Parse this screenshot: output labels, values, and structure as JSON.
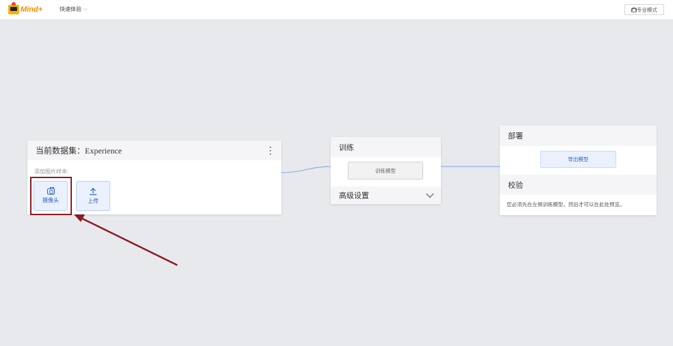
{
  "app": {
    "logo_text": "Mind+",
    "mode_menu_label": "快速体验",
    "pro_mode_label": "专业模式"
  },
  "dataset": {
    "title": "当前数据集：Experience",
    "subtitle": "添加图片样本:",
    "webcam_label": "摄像头",
    "upload_label": "上传"
  },
  "train": {
    "title": "训练",
    "train_button_label": "训练模型",
    "advanced_label": "高级设置"
  },
  "deploy": {
    "title": "部署",
    "export_button_label": "导出模型",
    "validate_title": "校验",
    "validate_message": "您必须先在左侧训练模型，然后才可以在此处预览。"
  },
  "colors": {
    "accent": "#2f62c7",
    "highlight": "#8a1b22",
    "background": "#e8e9ed"
  }
}
